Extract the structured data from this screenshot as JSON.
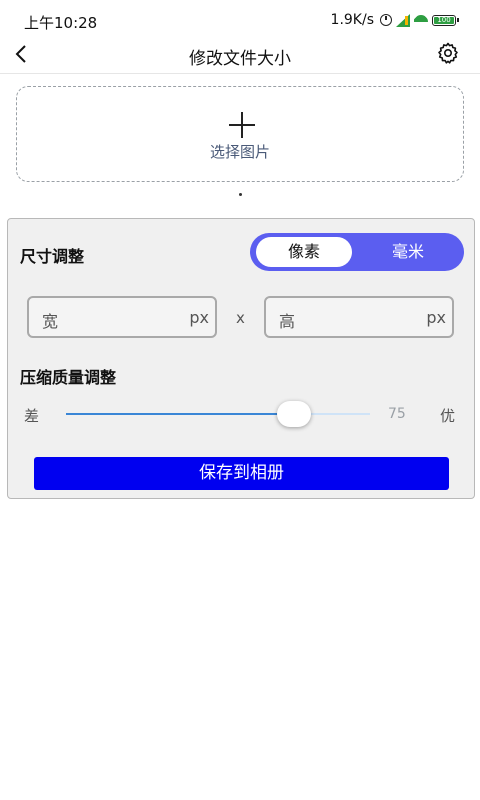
{
  "status_bar": {
    "time": "上午10:28",
    "net_speed": "1.9K/s",
    "battery": "100"
  },
  "header": {
    "title": "修改文件大小"
  },
  "select_image": {
    "label": "选择图片"
  },
  "size_section": {
    "title": "尺寸调整",
    "unit_options": [
      "像素",
      "毫米"
    ],
    "selected_unit": "像素",
    "width_placeholder": "宽",
    "height_placeholder": "高",
    "unit_suffix": "px",
    "separator": "x"
  },
  "quality_section": {
    "title": "压缩质量调整",
    "low_label": "差",
    "high_label": "优",
    "value": 75,
    "value_text": "75",
    "min": 0,
    "max": 100
  },
  "save_button": {
    "label": "保存到相册"
  },
  "colors": {
    "toggle_bg": "#5b5ef0",
    "save_bg": "#0000f0",
    "slider_fill": "#3a86d6"
  }
}
